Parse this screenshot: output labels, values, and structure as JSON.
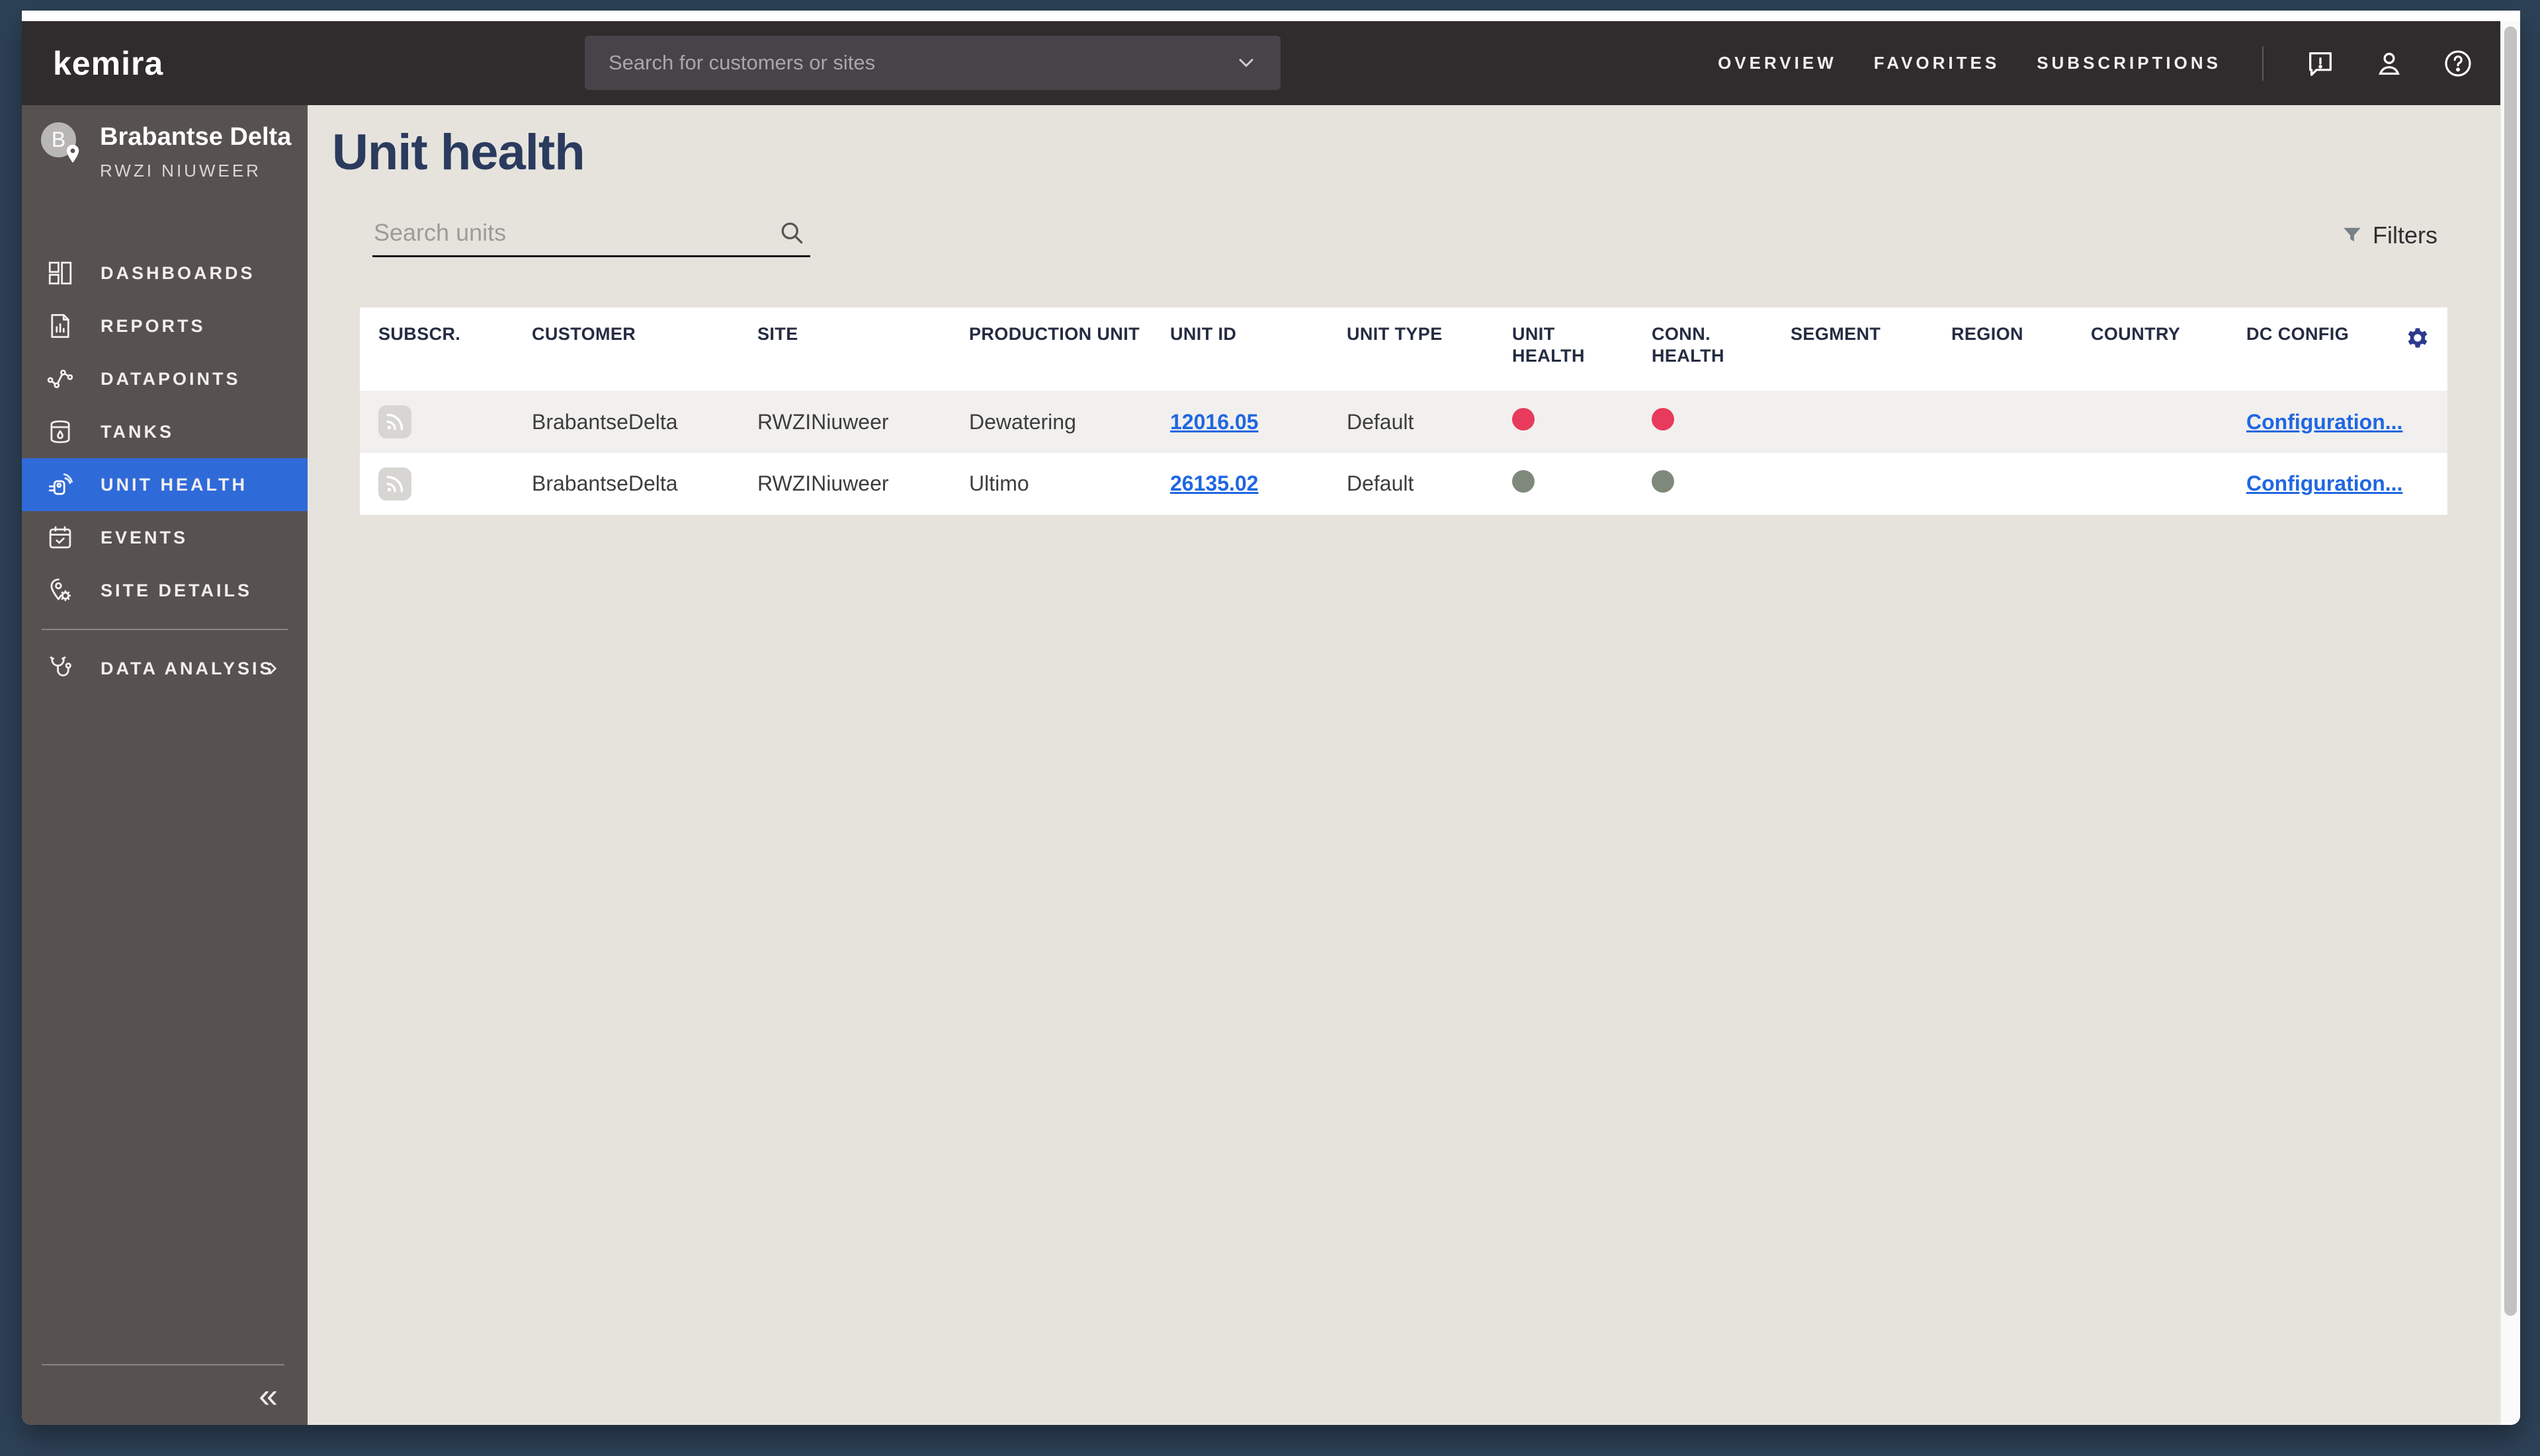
{
  "topbar": {
    "logo": "kemira",
    "search_placeholder": "Search for customers or sites",
    "nav": [
      {
        "label": "OVERVIEW"
      },
      {
        "label": "FAVORITES"
      },
      {
        "label": "SUBSCRIPTIONS"
      }
    ]
  },
  "sidebar": {
    "customer_initial": "B",
    "customer_name": "Brabantse Delta",
    "site_name": "RWZI NIUWEER",
    "items": [
      {
        "label": "DASHBOARDS"
      },
      {
        "label": "REPORTS"
      },
      {
        "label": "DATAPOINTS"
      },
      {
        "label": "TANKS"
      },
      {
        "label": "UNIT HEALTH"
      },
      {
        "label": "EVENTS"
      },
      {
        "label": "SITE DETAILS"
      },
      {
        "label": "DATA ANALYSIS"
      }
    ],
    "active_item": "UNIT HEALTH",
    "collapse_icon": "«"
  },
  "main": {
    "title": "Unit health",
    "search_placeholder": "Search units",
    "filters_label": "Filters",
    "table": {
      "columns": [
        "SUBSCR.",
        "CUSTOMER",
        "SITE",
        "PRODUCTION UNIT",
        "UNIT ID",
        "UNIT TYPE",
        "UNIT HEALTH",
        "CONN. HEALTH",
        "SEGMENT",
        "REGION",
        "COUNTRY",
        "DC CONFIG"
      ],
      "rows": [
        {
          "customer": "BrabantseDelta",
          "site": "RWZINiuweer",
          "production_unit": "Dewatering",
          "unit_id": "12016.05",
          "unit_type": "Default",
          "unit_health": "red",
          "conn_health": "red",
          "segment": "",
          "region": "",
          "country": "",
          "dc_config": "Configuration..."
        },
        {
          "customer": "BrabantseDelta",
          "site": "RWZINiuweer",
          "production_unit": "Ultimo",
          "unit_id": "26135.02",
          "unit_type": "Default",
          "unit_health": "gray",
          "conn_health": "gray",
          "segment": "",
          "region": "",
          "country": "",
          "dc_config": "Configuration..."
        }
      ]
    },
    "colors": {
      "health_red": "#e73a5d",
      "health_gray": "#7f897b",
      "link_blue": "#2067e2",
      "accent_blue": "#2f6ad9",
      "gear_blue": "#2d3a8d"
    }
  }
}
